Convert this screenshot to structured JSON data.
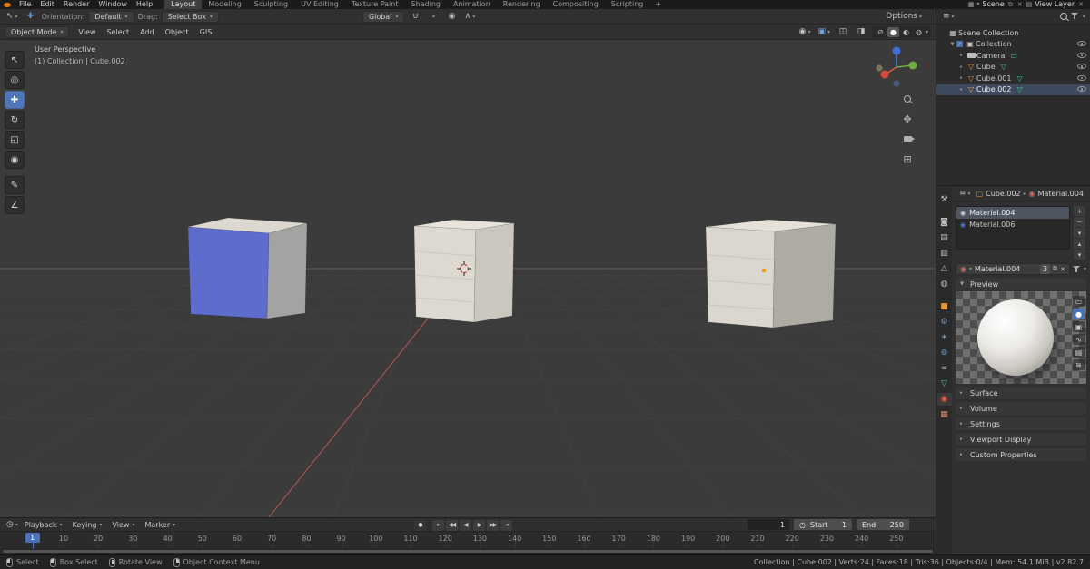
{
  "topbar": {
    "menus": [
      "File",
      "Edit",
      "Render",
      "Window",
      "Help"
    ],
    "workspaces": [
      "Layout",
      "Modeling",
      "Sculpting",
      "UV Editing",
      "Texture Paint",
      "Shading",
      "Animation",
      "Rendering",
      "Compositing",
      "Scripting"
    ],
    "active_workspace": "Layout",
    "add_tab": "+",
    "scene": {
      "label": "Scene"
    },
    "view_layer": {
      "label": "View Layer"
    }
  },
  "icons": {
    "caret": "▾",
    "close": "✕",
    "copy": "⧉",
    "record": "●",
    "clock": "◷",
    "menu": "≡",
    "scene_grid": "▦",
    "layers": "▤",
    "sphere": "◉",
    "image": "▣",
    "overlay_a": "◫",
    "overlay_b": "◨",
    "wire": "⊘",
    "solid": "●",
    "material_shade": "◐",
    "rendered": "◍",
    "magnet": "∪",
    "prop_edit": "◉",
    "prop_falloff": "∧",
    "crumb_object": "▢",
    "crumb_material": "◉",
    "crumb_sep": "▸",
    "arrow_right": "▸",
    "arrow_down": "▼",
    "check": "✓",
    "persp_grid": "⊞",
    "pan": "✥",
    "active_tool": "↖",
    "move_indicator": "✚"
  },
  "tool_settings": {
    "orientation_label": "Orientation:",
    "orientation_value": "Default",
    "drag_label": "Drag:",
    "drag_value": "Select Box",
    "pivot_value": "Global",
    "options_label": "Options"
  },
  "viewport_header": {
    "mode": "Object Mode",
    "menus": [
      "View",
      "Select",
      "Add",
      "Object",
      "GIS"
    ]
  },
  "toolbar_tools": [
    {
      "name": "select-box",
      "glyph": "↖"
    },
    {
      "name": "cursor",
      "glyph": "◎"
    },
    {
      "name": "move",
      "glyph": "✚",
      "active": true
    },
    {
      "name": "rotate",
      "glyph": "↻"
    },
    {
      "name": "scale",
      "glyph": "◱"
    },
    {
      "name": "transform",
      "glyph": "◉"
    },
    {
      "name": "annotate",
      "glyph": "✎",
      "gap": true
    },
    {
      "name": "measure",
      "glyph": "∠"
    }
  ],
  "nav": {
    "axis_x": "#d6493c",
    "axis_y": "#6fae3c",
    "axis_z": "#3d6fd6",
    "buttons": [
      {
        "name": "zoom",
        "css": "icon-mag"
      },
      {
        "name": "pan",
        "glyph": "✥"
      },
      {
        "name": "camera-view",
        "css": "icon-cam"
      },
      {
        "name": "toggle-perspective",
        "glyph": "⊞"
      }
    ]
  },
  "viewport": {
    "overlay_title": "User Perspective",
    "overlay_subtitle": "(1) Collection | Cube.002",
    "colors": {
      "background": "#3b3b3b",
      "grid": "#474747",
      "axis_y": "#877d5c",
      "relation": "#d06060",
      "cursor_ring": "#cc3d3d",
      "origin": "#f09c0c",
      "cube1_top": "#dcd8d0",
      "cube1_front": "#5e6ccd",
      "cube1_side": "#a3a3a2",
      "cube2_top": "#e7e3db",
      "cube2_front": "#ded9d0",
      "cube2_side": "#cbc7bf",
      "cube3_top": "#e5e1d9",
      "cube3_front": "#dbd7ce",
      "cube3_side": "#aeaba3"
    }
  },
  "outliner": {
    "rows": [
      {
        "label": "Scene Collection",
        "depth": 0,
        "glyph": "▦",
        "glyph_color": "#c9c9c9",
        "icon": "scene-collection-icon"
      },
      {
        "label": "Collection",
        "depth": 1,
        "arrow": "expanded",
        "checkbox": true,
        "glyph": "▣",
        "glyph_color": "#c9c9c9",
        "icon": "collection-icon",
        "eye": true
      },
      {
        "label": "Camera",
        "depth": 2,
        "arrow": "collapsed",
        "cam": true,
        "icon": "camera-icon",
        "extra_glyph": "▭",
        "extra_color": "#3fd08f",
        "extra_icon": "camera-data-icon",
        "eye": true
      },
      {
        "label": "Cube",
        "depth": 2,
        "arrow": "collapsed",
        "glyph": "▽",
        "glyph_color": "#e8983c",
        "icon": "mesh-object-icon",
        "extra_glyph": "▽",
        "extra_color": "#3fd08f",
        "extra_icon": "mesh-data-icon",
        "eye": true
      },
      {
        "label": "Cube.001",
        "depth": 2,
        "arrow": "collapsed",
        "glyph": "▽",
        "glyph_color": "#e8983c",
        "icon": "mesh-object-icon",
        "extra_glyph": "▽",
        "extra_color": "#3fd08f",
        "extra_icon": "mesh-data-icon",
        "eye": true
      },
      {
        "label": "Cube.002",
        "depth": 2,
        "arrow": "collapsed",
        "glyph": "▽",
        "glyph_color": "#f0a848",
        "icon": "mesh-object-icon",
        "extra_glyph": "▽",
        "extra_color": "#3fd08f",
        "extra_icon": "mesh-data-icon",
        "eye": true,
        "selected": true
      }
    ]
  },
  "properties": {
    "header": {
      "object": "Cube.002",
      "material": "Material.004"
    },
    "tabs": [
      {
        "name": "tool",
        "glyph": "⚒",
        "color": "#c0c0c0"
      },
      {
        "name": "render",
        "glyph": "◙",
        "color": "#c0c0c0",
        "gap": true
      },
      {
        "name": "output",
        "glyph": "▤",
        "color": "#c0c0c0"
      },
      {
        "name": "view-layer",
        "glyph": "▥",
        "color": "#c0c0c0"
      },
      {
        "name": "scene",
        "glyph": "△",
        "color": "#c0c0c0"
      },
      {
        "name": "world",
        "glyph": "◍",
        "color": "#c0c0c0"
      },
      {
        "name": "object",
        "glyph": "■",
        "color": "#e8983c",
        "gap": true
      },
      {
        "name": "modifiers",
        "glyph": "⚙",
        "color": "#6fa3dc"
      },
      {
        "name": "particles",
        "glyph": "∗",
        "color": "#6fa3dc"
      },
      {
        "name": "physics",
        "glyph": "⊚",
        "color": "#6fa3dc"
      },
      {
        "name": "constraints",
        "glyph": "∞",
        "color": "#c0c0c0"
      },
      {
        "name": "object-data",
        "glyph": "▽",
        "color": "#4ad49a"
      },
      {
        "name": "material",
        "glyph": "◉",
        "color": "#e25a4a",
        "active": true
      },
      {
        "name": "texture",
        "glyph": "▦",
        "color": "#d88878"
      }
    ],
    "slots": [
      {
        "name": "Material.004",
        "dot_color": "#d0d0d0",
        "selected": true
      },
      {
        "name": "Material.006",
        "dot_color": "#4a77e0"
      }
    ],
    "slot_buttons": [
      {
        "name": "add-material-slot",
        "glyph": "+"
      },
      {
        "name": "remove-material-slot",
        "glyph": "−"
      },
      {
        "name": "material-specials",
        "glyph": "▾"
      },
      {
        "name": "move-slot-up",
        "glyph": "▴"
      },
      {
        "name": "move-slot-down",
        "glyph": "▾"
      }
    ],
    "datablock": {
      "value": "Material.004",
      "users": "3"
    },
    "sections": [
      {
        "label": "Preview",
        "expanded": true
      },
      {
        "label": "Surface"
      },
      {
        "label": "Volume"
      },
      {
        "label": "Settings"
      },
      {
        "label": "Viewport Display"
      },
      {
        "label": "Custom Properties"
      }
    ],
    "preview_modes": [
      {
        "name": "flat",
        "glyph": "▭"
      },
      {
        "name": "sphere",
        "glyph": "●",
        "active": true
      },
      {
        "name": "cube",
        "glyph": "▣"
      },
      {
        "name": "hair",
        "glyph": "∿"
      },
      {
        "name": "cloth",
        "glyph": "▤"
      },
      {
        "name": "fluid",
        "glyph": "≋"
      }
    ]
  },
  "timeline": {
    "menus": [
      "Playback",
      "Keying",
      "View",
      "Marker"
    ],
    "transport": [
      {
        "name": "jump-to-start",
        "glyph": "⇤"
      },
      {
        "name": "prev-keyframe",
        "glyph": "◀◀"
      },
      {
        "name": "play-reverse",
        "glyph": "◀"
      },
      {
        "name": "play",
        "glyph": "▶"
      },
      {
        "name": "next-keyframe",
        "glyph": "▶▶"
      },
      {
        "name": "jump-to-end",
        "glyph": "⇥"
      }
    ],
    "frame_current": "1",
    "start_label": "Start",
    "start_value": "1",
    "end_label": "End",
    "end_value": "250",
    "ticks": [
      10,
      20,
      30,
      40,
      50,
      60,
      70,
      80,
      90,
      100,
      110,
      120,
      130,
      140,
      150,
      160,
      170,
      180,
      190,
      200,
      210,
      220,
      230,
      240,
      250
    ],
    "playhead": {
      "frame": 1,
      "label": "1"
    }
  },
  "statusbar": {
    "items_left": [
      {
        "label": "Select",
        "mouse": "left"
      },
      {
        "label": "Box Select",
        "mouse": "left"
      },
      {
        "label": "Rotate View",
        "mouse": "middle"
      },
      {
        "label": "Object Context Menu",
        "mouse": "right"
      }
    ],
    "info": "Collection | Cube.002 | Verts:24 | Faces:18 | Tris:36 | Objects:0/4 | Mem: 54.1 MiB | v2.82.7"
  }
}
